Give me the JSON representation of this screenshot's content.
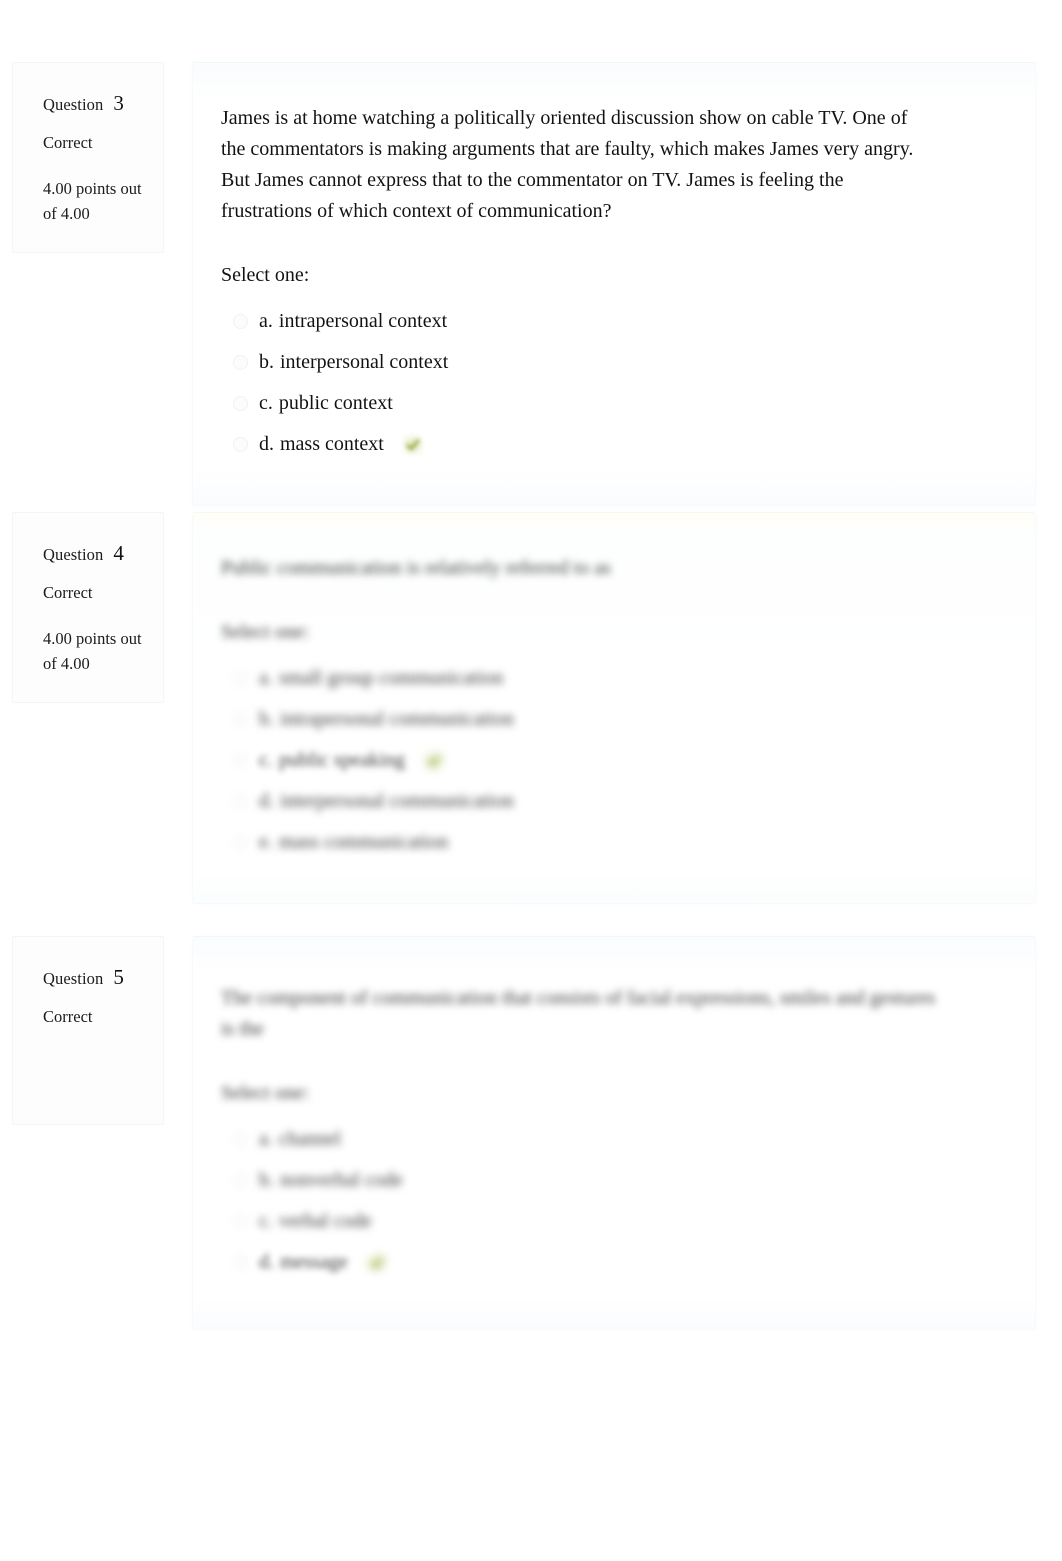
{
  "labels": {
    "question_word": "Question",
    "select_one": "Select one:",
    "correct_icon_name": "correct-check-icon"
  },
  "colors": {
    "panel_tint_blue": "#f7fbfd",
    "panel_tint_warm": "#fefdf8",
    "correct_green": "#d6e2a0",
    "text": "#121212"
  },
  "questions": [
    {
      "number": "3",
      "state": "Correct",
      "grade": "4.00 points out of 4.00",
      "blurred": false,
      "text": "James is at home watching a politically oriented discussion show on cable TV. One of the commentators is making arguments that are faulty, which makes James very angry. But James cannot express that to the commentator on TV. James is feeling the frustrations of which context of communication?",
      "select_one": "Select one:",
      "options": [
        {
          "letter": "a.",
          "label": "intrapersonal context",
          "correct": false
        },
        {
          "letter": "b.",
          "label": "interpersonal context",
          "correct": false
        },
        {
          "letter": "c.",
          "label": "public context",
          "correct": false
        },
        {
          "letter": "d.",
          "label": "mass context",
          "correct": true
        }
      ]
    },
    {
      "number": "4",
      "state": "Correct",
      "grade": "4.00 points out of 4.00",
      "blurred": true,
      "text": "Public communication is relatively referred to as",
      "select_one": "Select one:",
      "options": [
        {
          "letter": "a.",
          "label": "small group communication",
          "correct": false
        },
        {
          "letter": "b.",
          "label": "intrapersonal communication",
          "correct": false
        },
        {
          "letter": "c.",
          "label": "public speaking",
          "correct": true
        },
        {
          "letter": "d.",
          "label": "interpersonal communication",
          "correct": false
        },
        {
          "letter": "e.",
          "label": "mass communication",
          "correct": false
        }
      ]
    },
    {
      "number": "5",
      "state": "Correct",
      "grade": "",
      "blurred": true,
      "text": "The component of communication that consists of facial expressions, smiles and gestures is the",
      "select_one": "Select one:",
      "options": [
        {
          "letter": "a.",
          "label": "channel",
          "correct": false
        },
        {
          "letter": "b.",
          "label": "nonverbal code",
          "correct": false
        },
        {
          "letter": "c.",
          "label": "verbal code",
          "correct": false
        },
        {
          "letter": "d.",
          "label": "message",
          "correct": true
        }
      ]
    }
  ]
}
